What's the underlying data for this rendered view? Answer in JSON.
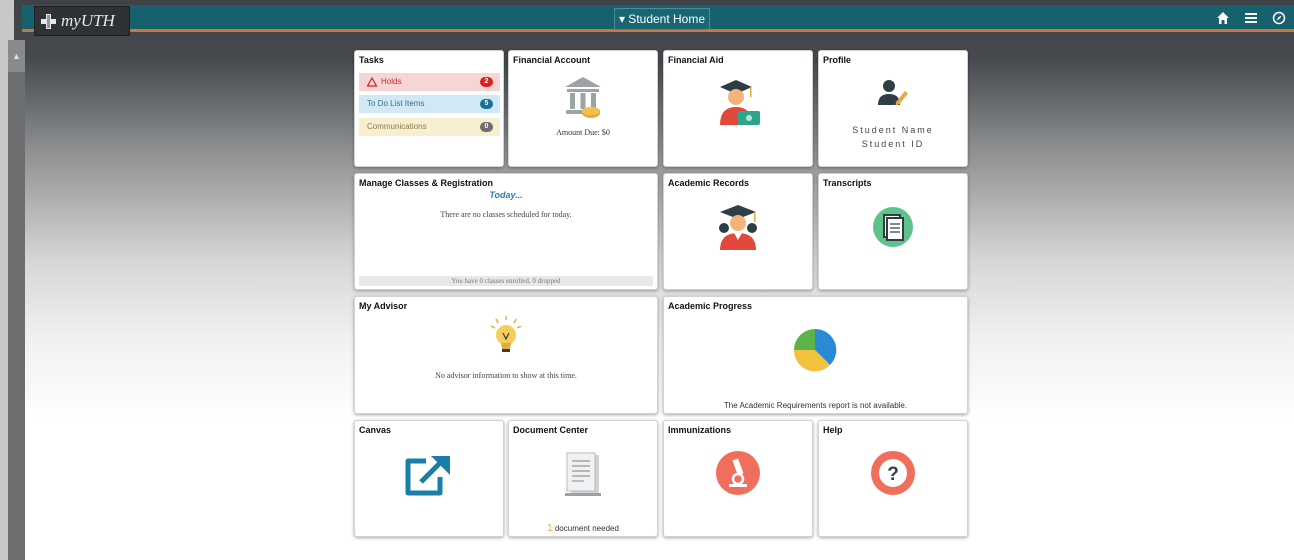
{
  "header": {
    "logo_text": "myUTH",
    "home_selector": "▾ Student Home",
    "icons": [
      "home-icon",
      "menu-icon",
      "compass-icon"
    ],
    "bar_color": "#17606e",
    "accent_color": "#c9773c"
  },
  "tiles": {
    "tasks": {
      "title": "Tasks",
      "items": [
        {
          "label": "Holds",
          "count": "2",
          "bg": "#f6d5d5",
          "badge_color": "#e02020"
        },
        {
          "label": "To Do List Items",
          "count": "5",
          "bg": "#d0e9f5",
          "badge_color": "#1a6e9c"
        },
        {
          "label": "Communications",
          "count": "0",
          "bg": "#f7efcf",
          "badge_color": "#6f6f6f"
        }
      ]
    },
    "financial_account": {
      "title": "Financial Account",
      "amount_due": "Amount Due: $0"
    },
    "financial_aid": {
      "title": "Financial Aid"
    },
    "profile": {
      "title": "Profile",
      "name": "Student Name",
      "id": "Student ID"
    },
    "manage_classes": {
      "title": "Manage Classes & Registration",
      "today": "Today...",
      "message": "There are no classes scheduled for today.",
      "footer": "You have 0 classes enrolled, 0 dropped"
    },
    "academic_records": {
      "title": "Academic Records"
    },
    "transcripts": {
      "title": "Transcripts"
    },
    "my_advisor": {
      "title": "My Advisor",
      "message": "No advisor information to show at this time."
    },
    "academic_progress": {
      "title": "Academic Progress",
      "message": "The Academic Requirements report is not available."
    },
    "canvas": {
      "title": "Canvas"
    },
    "document_center": {
      "title": "Document Center",
      "count": "1",
      "needed": "document needed"
    },
    "immunizations": {
      "title": "Immunizations"
    },
    "help": {
      "title": "Help"
    }
  }
}
